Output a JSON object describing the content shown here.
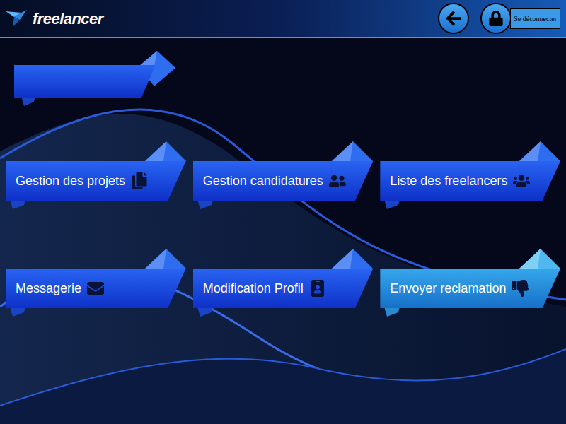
{
  "header": {
    "logo": "freelancer",
    "logout": "Se déconnecter"
  },
  "menu": [
    {
      "label": "Gestion des projets",
      "selected": false
    },
    {
      "label": "Gestion candidatures",
      "selected": false
    },
    {
      "label": "Liste des freelancers",
      "selected": false
    },
    {
      "label": "Messagerie",
      "selected": false
    },
    {
      "label": "Modification Profil",
      "selected": false
    },
    {
      "label": "Envoyer reclamation",
      "selected": true
    }
  ]
}
